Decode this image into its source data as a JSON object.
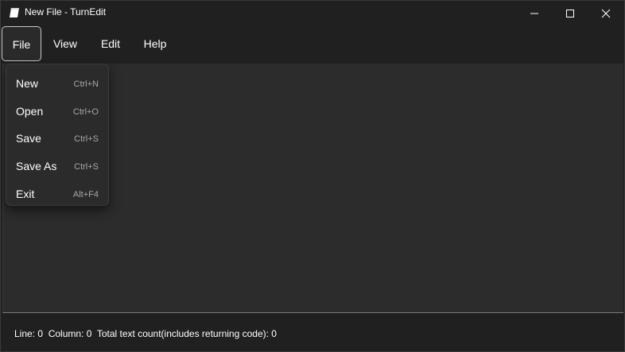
{
  "window": {
    "title": "New File - TurnEdit",
    "icon": "notepad-icon",
    "controls": {
      "minimize": "minimize-icon",
      "maximize": "maximize-icon",
      "close": "close-icon"
    }
  },
  "menubar": {
    "items": [
      {
        "label": "File",
        "active": true
      },
      {
        "label": "View"
      },
      {
        "label": "Edit"
      },
      {
        "label": "Help"
      }
    ]
  },
  "file_menu": {
    "items": [
      {
        "label": "New",
        "shortcut": "Ctrl+N"
      },
      {
        "label": "Open",
        "shortcut": "Ctrl+O"
      },
      {
        "label": "Save",
        "shortcut": "Ctrl+S"
      },
      {
        "label": "Save As",
        "shortcut": "Ctrl+S"
      },
      {
        "label": "Exit",
        "shortcut": "Alt+F4"
      }
    ]
  },
  "editor": {
    "content": ""
  },
  "statusbar": {
    "text": "Line: 0  Column: 0  Total text count(includes returning code): 0"
  },
  "colors": {
    "background": "#202020",
    "editor": "#2c2c2c",
    "menu": "#2b2b2b",
    "text": "#ffffff",
    "shortcut": "#a8a8a8"
  }
}
